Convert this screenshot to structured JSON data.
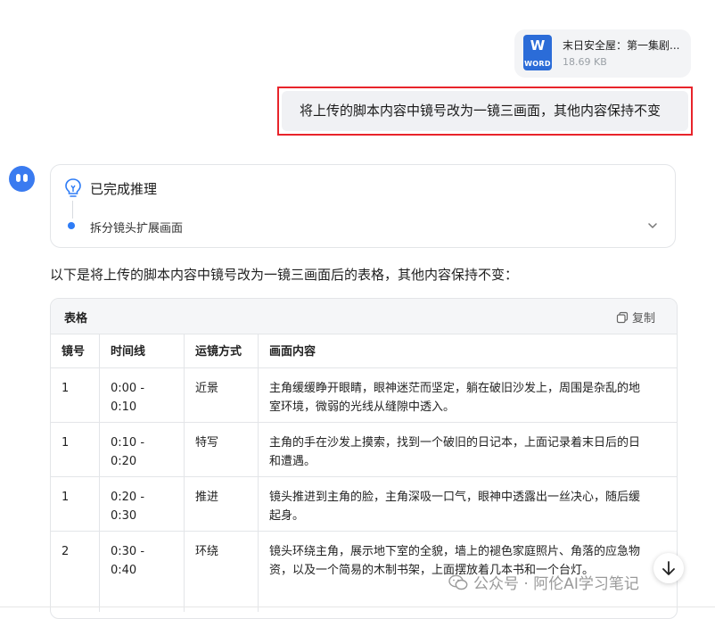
{
  "attachment": {
    "icon_top": "W",
    "icon_label": "WORD",
    "file_name": "末日安全屋：第一集剧...",
    "file_size": "18.69 KB"
  },
  "user_message": "将上传的脚本内容中镜号改为一镜三画面，其他内容保持不变",
  "reasoning": {
    "title": "已完成推理",
    "step": "拆分镜头扩展画面"
  },
  "intro_text": "以下是将上传的脚本内容中镜号改为一镜三画面后的表格，其他内容保持不变：",
  "table": {
    "title": "表格",
    "copy_label": "复制",
    "headers": [
      "镜号",
      "时间线",
      "运镜方式",
      "画面内容"
    ],
    "rows": [
      [
        "1",
        "0:00 - 0:10",
        "近景",
        "主角缓缓睁开眼睛，眼神迷茫而坚定，躺在破旧沙发上，周围是杂乱的地",
        "室环境，微弱的光线从缝隙中透入。"
      ],
      [
        "1",
        "0:10 - 0:20",
        "特写",
        "主角的手在沙发上摸索，找到一个破旧的日记本，上面记录着末日后的日",
        "和遭遇。"
      ],
      [
        "1",
        "0:20 - 0:30",
        "推进",
        "镜头推进到主角的脸，主角深吸一口气，眼神中透露出一丝决心，随后缓",
        "起身。"
      ],
      [
        "2",
        "0:30 - 0:40",
        "环绕",
        "镜头环绕主角，展示地下室的全貌，墙上的褪色家庭照片、角落的应急物",
        "资，以及一个简易的木制书架，上面摆放着几本书和一个台灯。"
      ]
    ]
  },
  "watermark": "公众号 · 阿伦AI学习笔记",
  "colors": {
    "accent_blue": "#2e7cf6",
    "highlight_red": "#e8242b",
    "word_blue": "#2b6cd8"
  }
}
